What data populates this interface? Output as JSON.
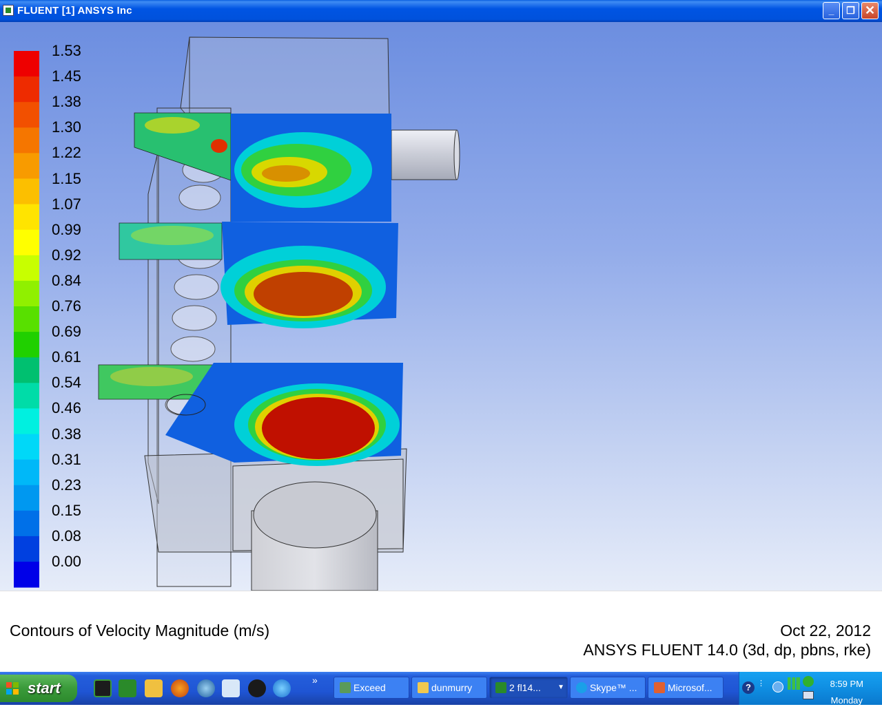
{
  "window": {
    "title": "FLUENT [1] ANSYS Inc",
    "minimize": "_",
    "maximize": "❐",
    "close": "✕"
  },
  "colorbar": {
    "labels": [
      "1.53",
      "1.45",
      "1.38",
      "1.30",
      "1.22",
      "1.15",
      "1.07",
      "0.99",
      "0.92",
      "0.84",
      "0.76",
      "0.69",
      "0.61",
      "0.54",
      "0.46",
      "0.38",
      "0.31",
      "0.23",
      "0.15",
      "0.08",
      "0.00"
    ],
    "colors": [
      "#ee0000",
      "#ee2b00",
      "#f25000",
      "#f57600",
      "#f89b00",
      "#fcbf00",
      "#ffe400",
      "#ffff00",
      "#c8ff00",
      "#90f000",
      "#58e000",
      "#20d000",
      "#00c070",
      "#00dca8",
      "#00f0e0",
      "#00d8f8",
      "#00b8f8",
      "#0098f0",
      "#0070e8",
      "#0040e0",
      "#0000e8"
    ]
  },
  "footer": {
    "title": "Contours of Velocity Magnitude (m/s)",
    "date": "Oct 22, 2012",
    "solver": "ANSYS FLUENT 14.0 (3d, dp, pbns, rke)"
  },
  "taskbar": {
    "start": "start",
    "more": "»",
    "items": [
      {
        "label": "Exceed",
        "icon_color": "#5a9a5a"
      },
      {
        "label": "dunmurry",
        "icon_color": "#f0c850"
      },
      {
        "label": "2 fl14...",
        "icon_color": "#2a8a2a",
        "active": true
      },
      {
        "label": "Skype™ ...",
        "icon_color": "#1aa0e8"
      },
      {
        "label": "Microsof...",
        "icon_color": "#e06030"
      }
    ],
    "clock_time": "8:59 PM",
    "clock_day": "Monday"
  }
}
